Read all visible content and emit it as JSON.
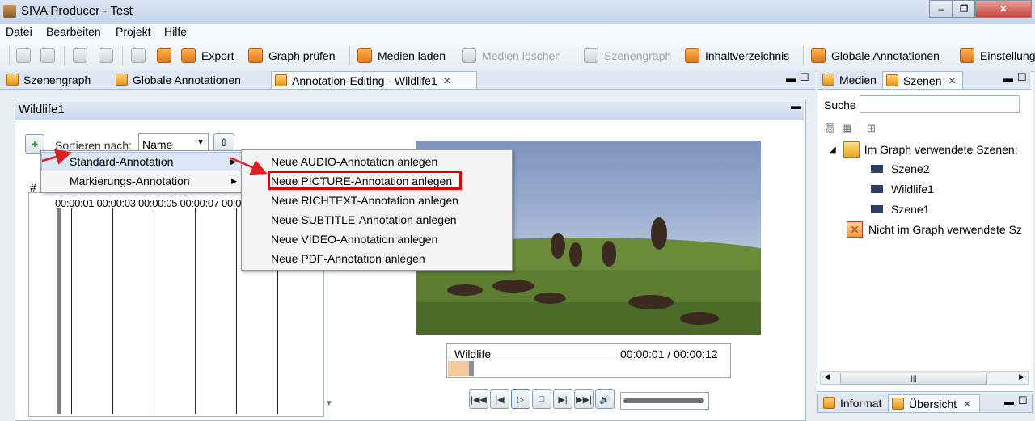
{
  "window": {
    "title": "SIVA Producer - Test",
    "controls": [
      "–",
      "❐",
      "✕"
    ]
  },
  "menu": [
    "Datei",
    "Bearbeiten",
    "Projekt",
    "Hilfe"
  ],
  "toolbar": {
    "export": "Export",
    "graph_check": "Graph prüfen",
    "load_media": "Medien laden",
    "delete_media": "Medien löschen",
    "scene_graph": "Szenengraph",
    "toc": "Inhaltverzeichnis",
    "global_annotations": "Globale Annotationen",
    "settings": "Einstellung"
  },
  "tabs": [
    {
      "label": "Szenengraph"
    },
    {
      "label": "Globale Annotationen"
    },
    {
      "label": "Annotation-Editing - Wildlife1",
      "close": "✕"
    }
  ],
  "editor": {
    "title": "Wildlife1",
    "add_button": "+",
    "sort_label": "Sortieren nach:",
    "sort_value": "Name",
    "column_hash": "#",
    "timeline_labels": "00:00:01 00:00:03 00:00:05 00:00:07 00:0",
    "video_name": "Wildlife",
    "time_display": "00:00:01 / 00:00:12",
    "seek_fraction": 0.0833
  },
  "context_menu": {
    "items": [
      "Standard-Annotation",
      "Markierungs-Annotation"
    ],
    "submenu": [
      "Neue AUDIO-Annotation anlegen",
      "Neue PICTURE-Annotation anlegen",
      "Neue RICHTEXT-Annotation anlegen",
      "Neue SUBTITLE-Annotation anlegen",
      "Neue VIDEO-Annotation anlegen",
      "Neue PDF-Annotation anlegen"
    ],
    "highlighted": "Neue PICTURE-Annotation anlegen"
  },
  "right_panel": {
    "tabs": [
      "Medien",
      "Szenen"
    ],
    "search_label": "Suche",
    "search_value": "",
    "used_scenes": "Im Graph verwendete Szenen:",
    "scenes": [
      "Szene2",
      "Wildlife1",
      "Szene1"
    ],
    "unused_scenes": "Nicht im Graph verwendete Sz"
  },
  "bottom_panel": {
    "tabs": [
      "Informat",
      "Übersicht"
    ]
  },
  "colors": {
    "highlight_box": "#e00000",
    "arrow": "#e02020",
    "accent": "#f0a030"
  }
}
